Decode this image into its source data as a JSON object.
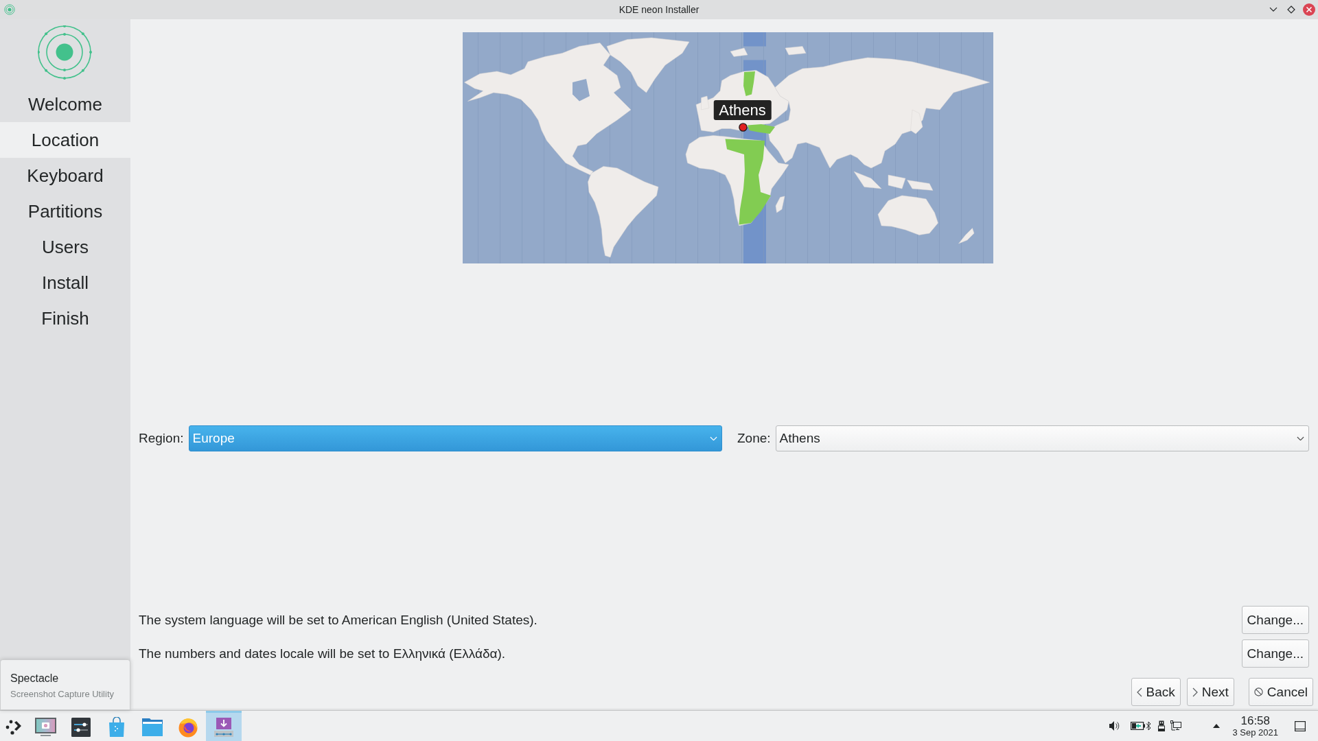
{
  "window": {
    "title": "KDE neon Installer"
  },
  "sidebar": {
    "steps": [
      {
        "label": "Welcome",
        "selected": false
      },
      {
        "label": "Location",
        "selected": true
      },
      {
        "label": "Keyboard",
        "selected": false
      },
      {
        "label": "Partitions",
        "selected": false
      },
      {
        "label": "Users",
        "selected": false
      },
      {
        "label": "Install",
        "selected": false
      },
      {
        "label": "Finish",
        "selected": false
      }
    ]
  },
  "location": {
    "map": {
      "marker_label": "Athens"
    },
    "region": {
      "label": "Region:",
      "value": "Europe",
      "focused": true
    },
    "zone": {
      "label": "Zone:",
      "value": "Athens",
      "focused": false
    }
  },
  "locale_lines": [
    {
      "text": "The system language will be set to American English (United States).",
      "button": "Change..."
    },
    {
      "text": "The numbers and dates locale will be set to Ελληνικά (Ελλάδα).",
      "button": "Change..."
    }
  ],
  "navigation": [
    {
      "kind": "back",
      "label": "Back"
    },
    {
      "kind": "next",
      "label": "Next"
    },
    {
      "kind": "cancel",
      "label": "Cancel"
    }
  ],
  "tooltip": {
    "title": "Spectacle",
    "subtitle": "Screenshot Capture Utility"
  },
  "taskbar": {
    "items": [
      {
        "kind": "menu",
        "selected": false
      },
      {
        "kind": "screenshot",
        "selected": false
      },
      {
        "kind": "settings",
        "selected": false
      },
      {
        "kind": "store",
        "selected": false
      },
      {
        "kind": "files",
        "selected": false
      },
      {
        "kind": "browser",
        "selected": false
      },
      {
        "kind": "installer",
        "selected": true
      }
    ],
    "tray": [
      {
        "kind": "volume"
      },
      {
        "kind": "battery"
      },
      {
        "kind": "bluetooth"
      },
      {
        "kind": "usb"
      },
      {
        "kind": "network"
      },
      {
        "kind": "expand"
      }
    ],
    "clock": {
      "time": "16:58",
      "date": "3 Sep 2021"
    }
  }
}
